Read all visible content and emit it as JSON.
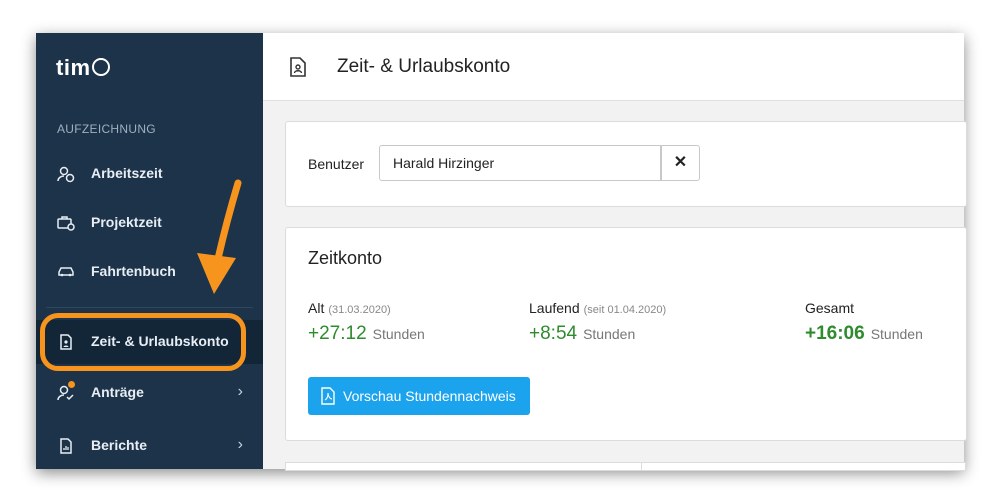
{
  "app": {
    "logo_text": "tim"
  },
  "sidebar": {
    "section_label": "AUFZEICHNUNG",
    "items": [
      {
        "label": "Arbeitszeit",
        "icon": "user-clock-icon"
      },
      {
        "label": "Projektzeit",
        "icon": "briefcase-clock-icon"
      },
      {
        "label": "Fahrtenbuch",
        "icon": "car-icon"
      },
      {
        "label": "Zeit- & Urlaubskonto",
        "icon": "document-person-icon",
        "active": true
      },
      {
        "label": "Anträge",
        "icon": "user-check-icon",
        "chevron": "›"
      },
      {
        "label": "Berichte",
        "icon": "report-icon",
        "chevron": "›"
      }
    ]
  },
  "header": {
    "title": "Zeit- & Urlaubskonto"
  },
  "user_filter": {
    "label": "Benutzer",
    "value": "Harald Hirzinger",
    "clear": "✕"
  },
  "zeitkonto": {
    "title": "Zeitkonto",
    "stats": [
      {
        "label": "Alt",
        "sub": "(31.03.2020)",
        "value": "+27:12",
        "unit": "Stunden"
      },
      {
        "label": "Laufend",
        "sub": "(seit 01.04.2020)",
        "value": "+8:54",
        "unit": "Stunden"
      },
      {
        "label": "Gesamt",
        "sub": "",
        "value": "+16:06",
        "unit": "Stunden"
      }
    ],
    "button_label": "Vorschau Stundennachweis"
  },
  "colors": {
    "sidebar": "#1c3349",
    "accent": "#1ba3ee",
    "positive": "#2e8b2e",
    "highlight": "#f7941d"
  }
}
